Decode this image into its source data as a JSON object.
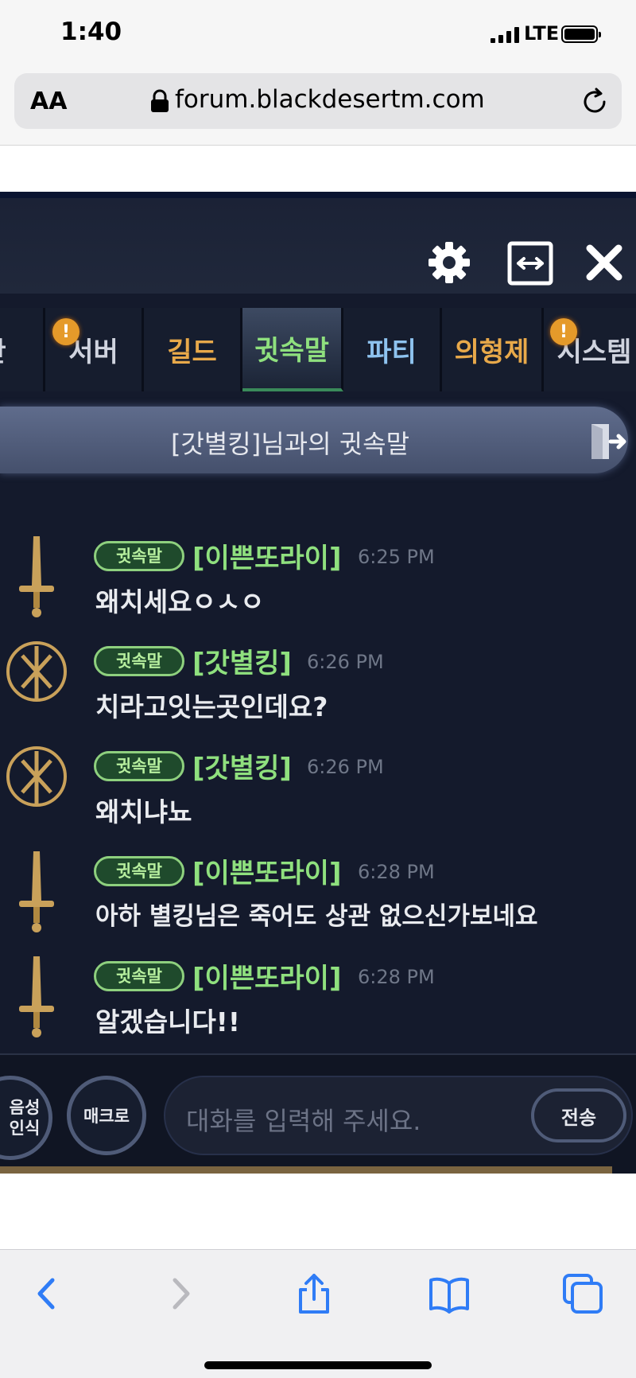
{
  "status_bar": {
    "time": "1:40",
    "network": "LTE"
  },
  "browser": {
    "text_size_label": "AA",
    "url": "forum.blackdesertm.com"
  },
  "game_chat": {
    "tabs": [
      {
        "label": "반",
        "color": "#cfd3de",
        "badge": false
      },
      {
        "label": "서버",
        "color": "#cfd3de",
        "badge": true
      },
      {
        "label": "길드",
        "color": "#e8a94a",
        "badge": false
      },
      {
        "label": "귓속말",
        "color": "#8fe07e",
        "badge": false,
        "active": true
      },
      {
        "label": "파티",
        "color": "#8ec3ef",
        "badge": false
      },
      {
        "label": "의형제",
        "color": "#e8a94a",
        "badge": false
      },
      {
        "label": "시스템",
        "color": "#cfd3de",
        "badge": true
      }
    ],
    "badge_symbol": "!",
    "conversation_title": "[갓별킹]님과의 귓속말",
    "messages": [
      {
        "tag": "귓속말",
        "sender": "[이쁜또라이]",
        "time": "6:25 PM",
        "text": "왜치세요ㅇㅅㅇ",
        "avatar": "sword-icon"
      },
      {
        "tag": "귓속말",
        "sender": "[갓별킹]",
        "time": "6:26 PM",
        "text": "치라고잇는곳인데요?",
        "avatar": "emblem-icon"
      },
      {
        "tag": "귓속말",
        "sender": "[갓별킹]",
        "time": "6:26 PM",
        "text": "왜치냐뇨",
        "avatar": "emblem-icon"
      },
      {
        "tag": "귓속말",
        "sender": "[이쁜또라이]",
        "time": "6:28 PM",
        "text": "아하 별킹님은 죽어도 상관 없으신가보네요",
        "avatar": "sword-icon"
      },
      {
        "tag": "귓속말",
        "sender": "[이쁜또라이]",
        "time": "6:28 PM",
        "text": "알겠습니다!!",
        "avatar": "sword-icon"
      }
    ],
    "input": {
      "voice_button": "음성\n인식",
      "macro_button": "매크로",
      "placeholder": "대화를 입력해 주세요.",
      "send_button": "전송"
    }
  },
  "colors": {
    "game_bg": "#141a2c",
    "whisper_green": "#8fe07e",
    "badge_orange": "#e59a2a",
    "ios_blue": "#2f7cf6"
  }
}
